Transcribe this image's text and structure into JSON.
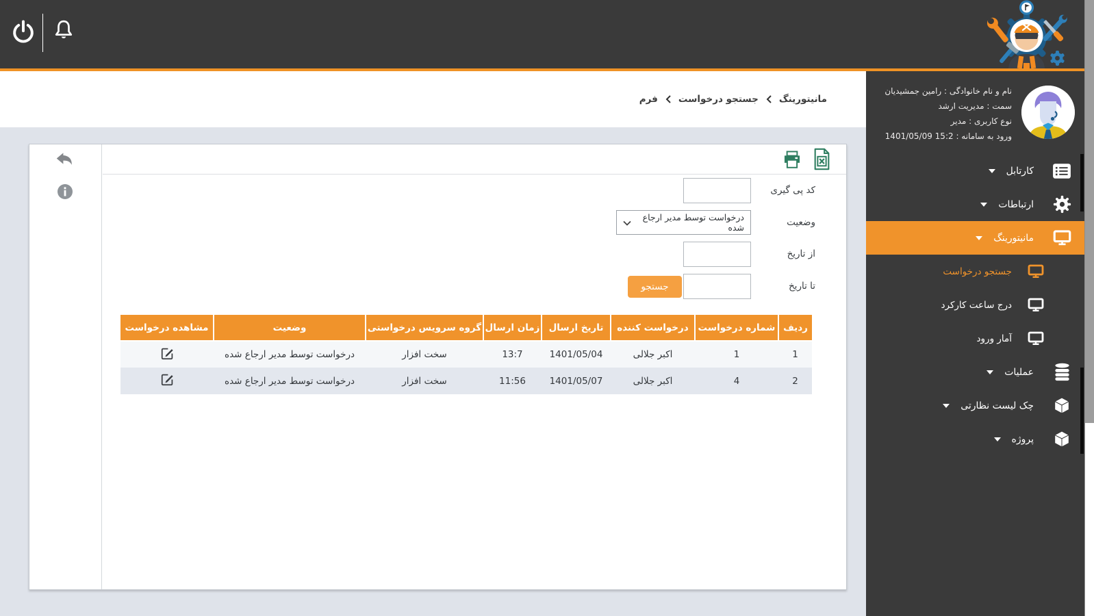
{
  "colors": {
    "accent_orange": "#f0932b",
    "topbar_orange_line": "#ef9225",
    "dark_bg": "#3a3a3a",
    "content_bg": "#dfe3ea",
    "icon_teal": "#2f7e61",
    "row_odd_bg": "#f5f7f9",
    "row_even_bg": "#e3e7ee"
  },
  "topbar": {
    "icons": [
      "power-icon",
      "notification-bell-icon"
    ],
    "logo": "support-services-worker-logo"
  },
  "sidebar": {
    "user": {
      "full_name": "نام و نام خانوادگی : رامین جمشیدیان",
      "position": "سمت : مدیریت ارشد",
      "user_type": "نوع کاربری : مدیر",
      "login_time": "ورود به سامانه : 15:2 1401/05/09"
    },
    "menu": [
      {
        "label": "کارتابل",
        "icon": "cartable-list-icon",
        "expandable": true
      },
      {
        "label": "ارتباطات",
        "icon": "communications-gear-icon",
        "expandable": true
      },
      {
        "label": "مانیتورینگ",
        "icon": "monitoring-monitor-icon",
        "expandable": true,
        "active": true
      },
      {
        "label": "جستجو درخواست",
        "icon": "monitor-icon",
        "submenu": true,
        "active": true
      },
      {
        "label": "درج ساعت کارکرد",
        "icon": "monitor-icon",
        "submenu": true
      },
      {
        "label": "آمار ورود",
        "icon": "monitor-icon",
        "submenu": true
      },
      {
        "label": "عملیات",
        "icon": "operations-database-icon",
        "expandable": true
      },
      {
        "label": "چک لیست نظارتی",
        "icon": "checklist-cube-icon",
        "expandable": true
      },
      {
        "label": "پروژه",
        "icon": "project-cube-icon",
        "expandable": true
      }
    ]
  },
  "breadcrumb": {
    "items": [
      "مانیتورینگ",
      "جستجو درخواست",
      "فرم"
    ],
    "separator": "left-chevron"
  },
  "card": {
    "toolbar_icons": [
      "print-icon",
      "excel-export-icon"
    ],
    "side_icons": [
      "back-icon",
      "info-icon"
    ]
  },
  "form": {
    "tracking_code_label": "کد پی گیری",
    "status_label": "وضعیت",
    "status_value": "درخواست توسط مدیر ارجاع شده",
    "from_date_label": "از تاریخ",
    "to_date_label": "تا تاریخ",
    "search_button": "جستجو"
  },
  "table": {
    "headers": [
      "ردیف",
      "شماره درخواست",
      "درخواست کننده",
      "تاریخ ارسال",
      "زمان ارسال",
      "گروه سرویس درخواستی",
      "وضعیت",
      "مشاهده درخواست"
    ],
    "rows": [
      {
        "cells": [
          "1",
          "1",
          "اکبر جلالی",
          "1401/05/04",
          "13:7",
          "سخت افزار",
          "درخواست توسط مدیر ارجاع شده"
        ]
      },
      {
        "cells": [
          "2",
          "4",
          "اکبر جلالی",
          "1401/05/07",
          "11:56",
          "سخت افزار",
          "درخواست توسط مدیر ارجاع شده"
        ]
      }
    ],
    "view_icon": "edit-view-icon"
  }
}
